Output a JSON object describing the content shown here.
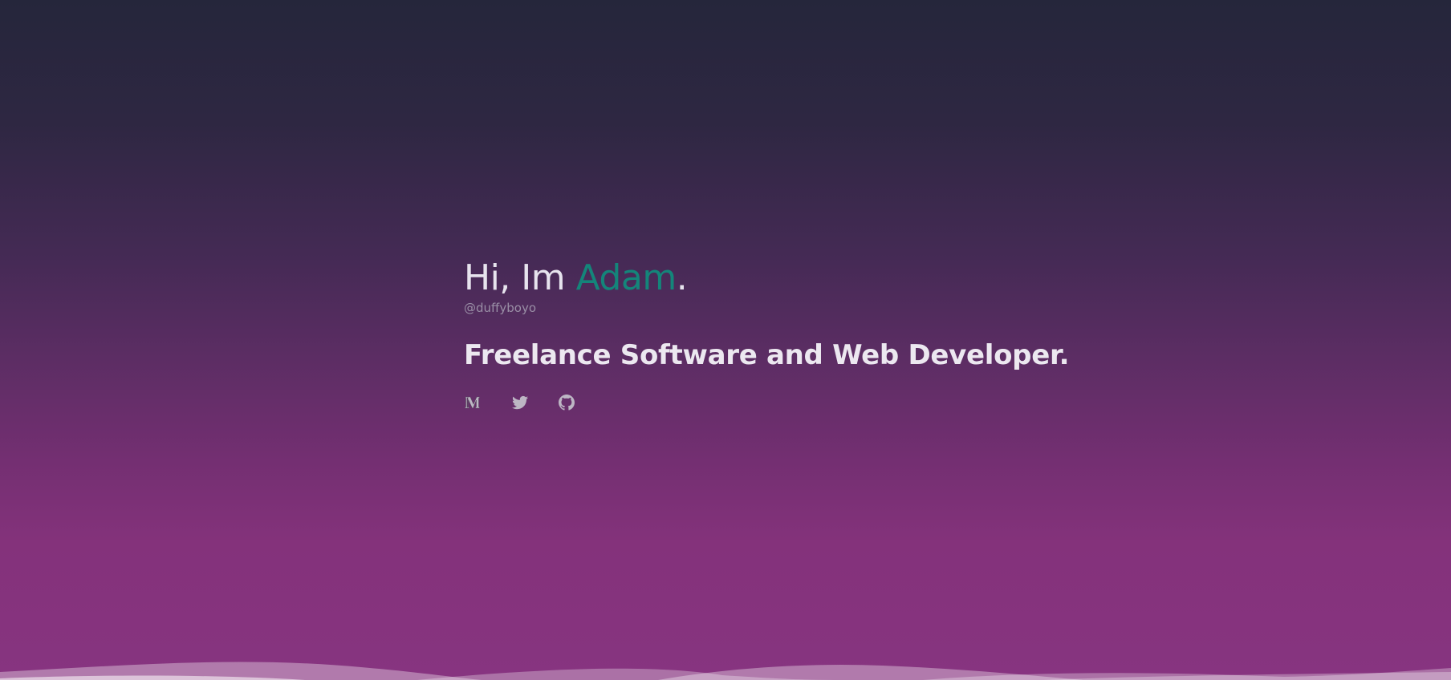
{
  "hero": {
    "greeting_prefix": "Hi, Im ",
    "name": "Adam",
    "greeting_suffix": ".",
    "handle": "@duffyboyo",
    "tagline": "Freelance Software and Web Developer."
  },
  "socials": [
    {
      "icon": "medium-icon"
    },
    {
      "icon": "twitter-icon"
    },
    {
      "icon": "github-icon"
    }
  ],
  "colors": {
    "accent": "#14857a",
    "text": "#e7e4ee",
    "muted": "#9a8fa6",
    "icon": "#bdb6c4",
    "gradient_top": "#25263b",
    "gradient_bottom": "#873480"
  }
}
